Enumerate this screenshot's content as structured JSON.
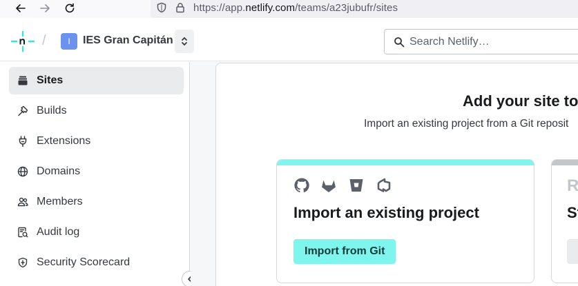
{
  "browser": {
    "back_icon": "arrow-left-icon",
    "forward_icon": "arrow-right-icon",
    "reload_icon": "reload-icon",
    "url_prefix": "https://app.",
    "url_domain": "netlify.com",
    "url_path": "/teams/a23jubufr/sites"
  },
  "header": {
    "team_initial": "I",
    "team_name": "IES Gran Capitán",
    "search_placeholder": "Search Netlify…",
    "accent_color": "#32e6e2"
  },
  "sidebar": {
    "items": [
      {
        "label": "Sites",
        "icon": "layers-icon",
        "active": true
      },
      {
        "label": "Builds",
        "icon": "hammer-icon"
      },
      {
        "label": "Extensions",
        "icon": "plug-icon"
      },
      {
        "label": "Domains",
        "icon": "globe-icon"
      },
      {
        "label": "Members",
        "icon": "users-icon"
      },
      {
        "label": "Audit log",
        "icon": "audit-icon"
      },
      {
        "label": "Security Scorecard",
        "icon": "shield-icon"
      }
    ]
  },
  "main": {
    "title": "Add your site to N",
    "subtitle": "Import an existing project from a Git reposit",
    "import_card": {
      "title": "Import an existing project",
      "button_label": "Import from Git",
      "providers": [
        "github-icon",
        "gitlab-icon",
        "bitbucket-icon",
        "azure-devops-icon"
      ],
      "accent_color": "#7ef5ed"
    },
    "second_card": {
      "title_visible": "St",
      "icon_visible": "R"
    }
  }
}
